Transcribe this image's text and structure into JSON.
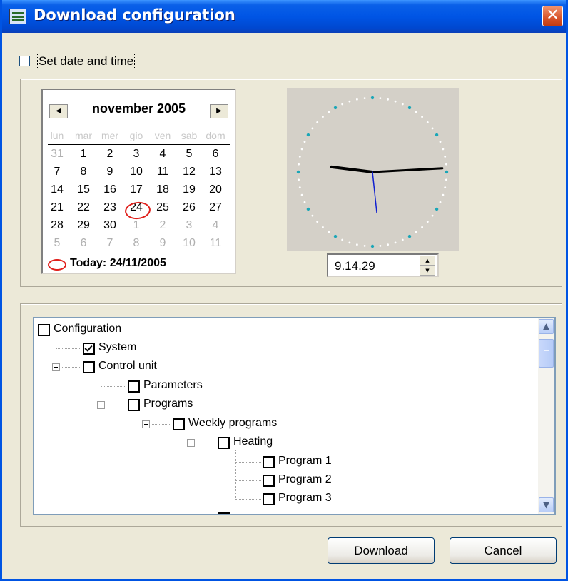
{
  "window": {
    "title": "Download configuration",
    "close_icon": "close-icon"
  },
  "datetime": {
    "checkbox_label": "Set date and time",
    "checked": false
  },
  "calendar": {
    "month_year": "november 2005",
    "weekdays": [
      "lun",
      "mar",
      "mer",
      "gio",
      "ven",
      "sab",
      "dom"
    ],
    "weeks": [
      [
        "31",
        "1",
        "2",
        "3",
        "4",
        "5",
        "6"
      ],
      [
        "7",
        "8",
        "9",
        "10",
        "11",
        "12",
        "13"
      ],
      [
        "14",
        "15",
        "16",
        "17",
        "18",
        "19",
        "20"
      ],
      [
        "21",
        "22",
        "23",
        "24",
        "25",
        "26",
        "27"
      ],
      [
        "28",
        "29",
        "30",
        "1",
        "2",
        "3",
        "4"
      ],
      [
        "5",
        "6",
        "7",
        "8",
        "9",
        "10",
        "11"
      ]
    ],
    "selected_day": "24",
    "today_label": "Today: 24/11/2005",
    "accent_color": "#e0201c"
  },
  "clock": {
    "time": "9.14.29",
    "hours": 9,
    "minutes": 14,
    "seconds": 29
  },
  "tree": {
    "nodes": [
      {
        "label": "Configuration",
        "checked": false
      },
      {
        "label": "System",
        "checked": true
      },
      {
        "label": "Control unit",
        "checked": false
      },
      {
        "label": "Parameters",
        "checked": false
      },
      {
        "label": "Programs",
        "checked": false
      },
      {
        "label": "Weekly programs",
        "checked": false
      },
      {
        "label": "Heating",
        "checked": false
      },
      {
        "label": "Program 1",
        "checked": false
      },
      {
        "label": "Program 2",
        "checked": false
      },
      {
        "label": "Program 3",
        "checked": false
      }
    ]
  },
  "buttons": {
    "download": "Download",
    "cancel": "Cancel"
  }
}
